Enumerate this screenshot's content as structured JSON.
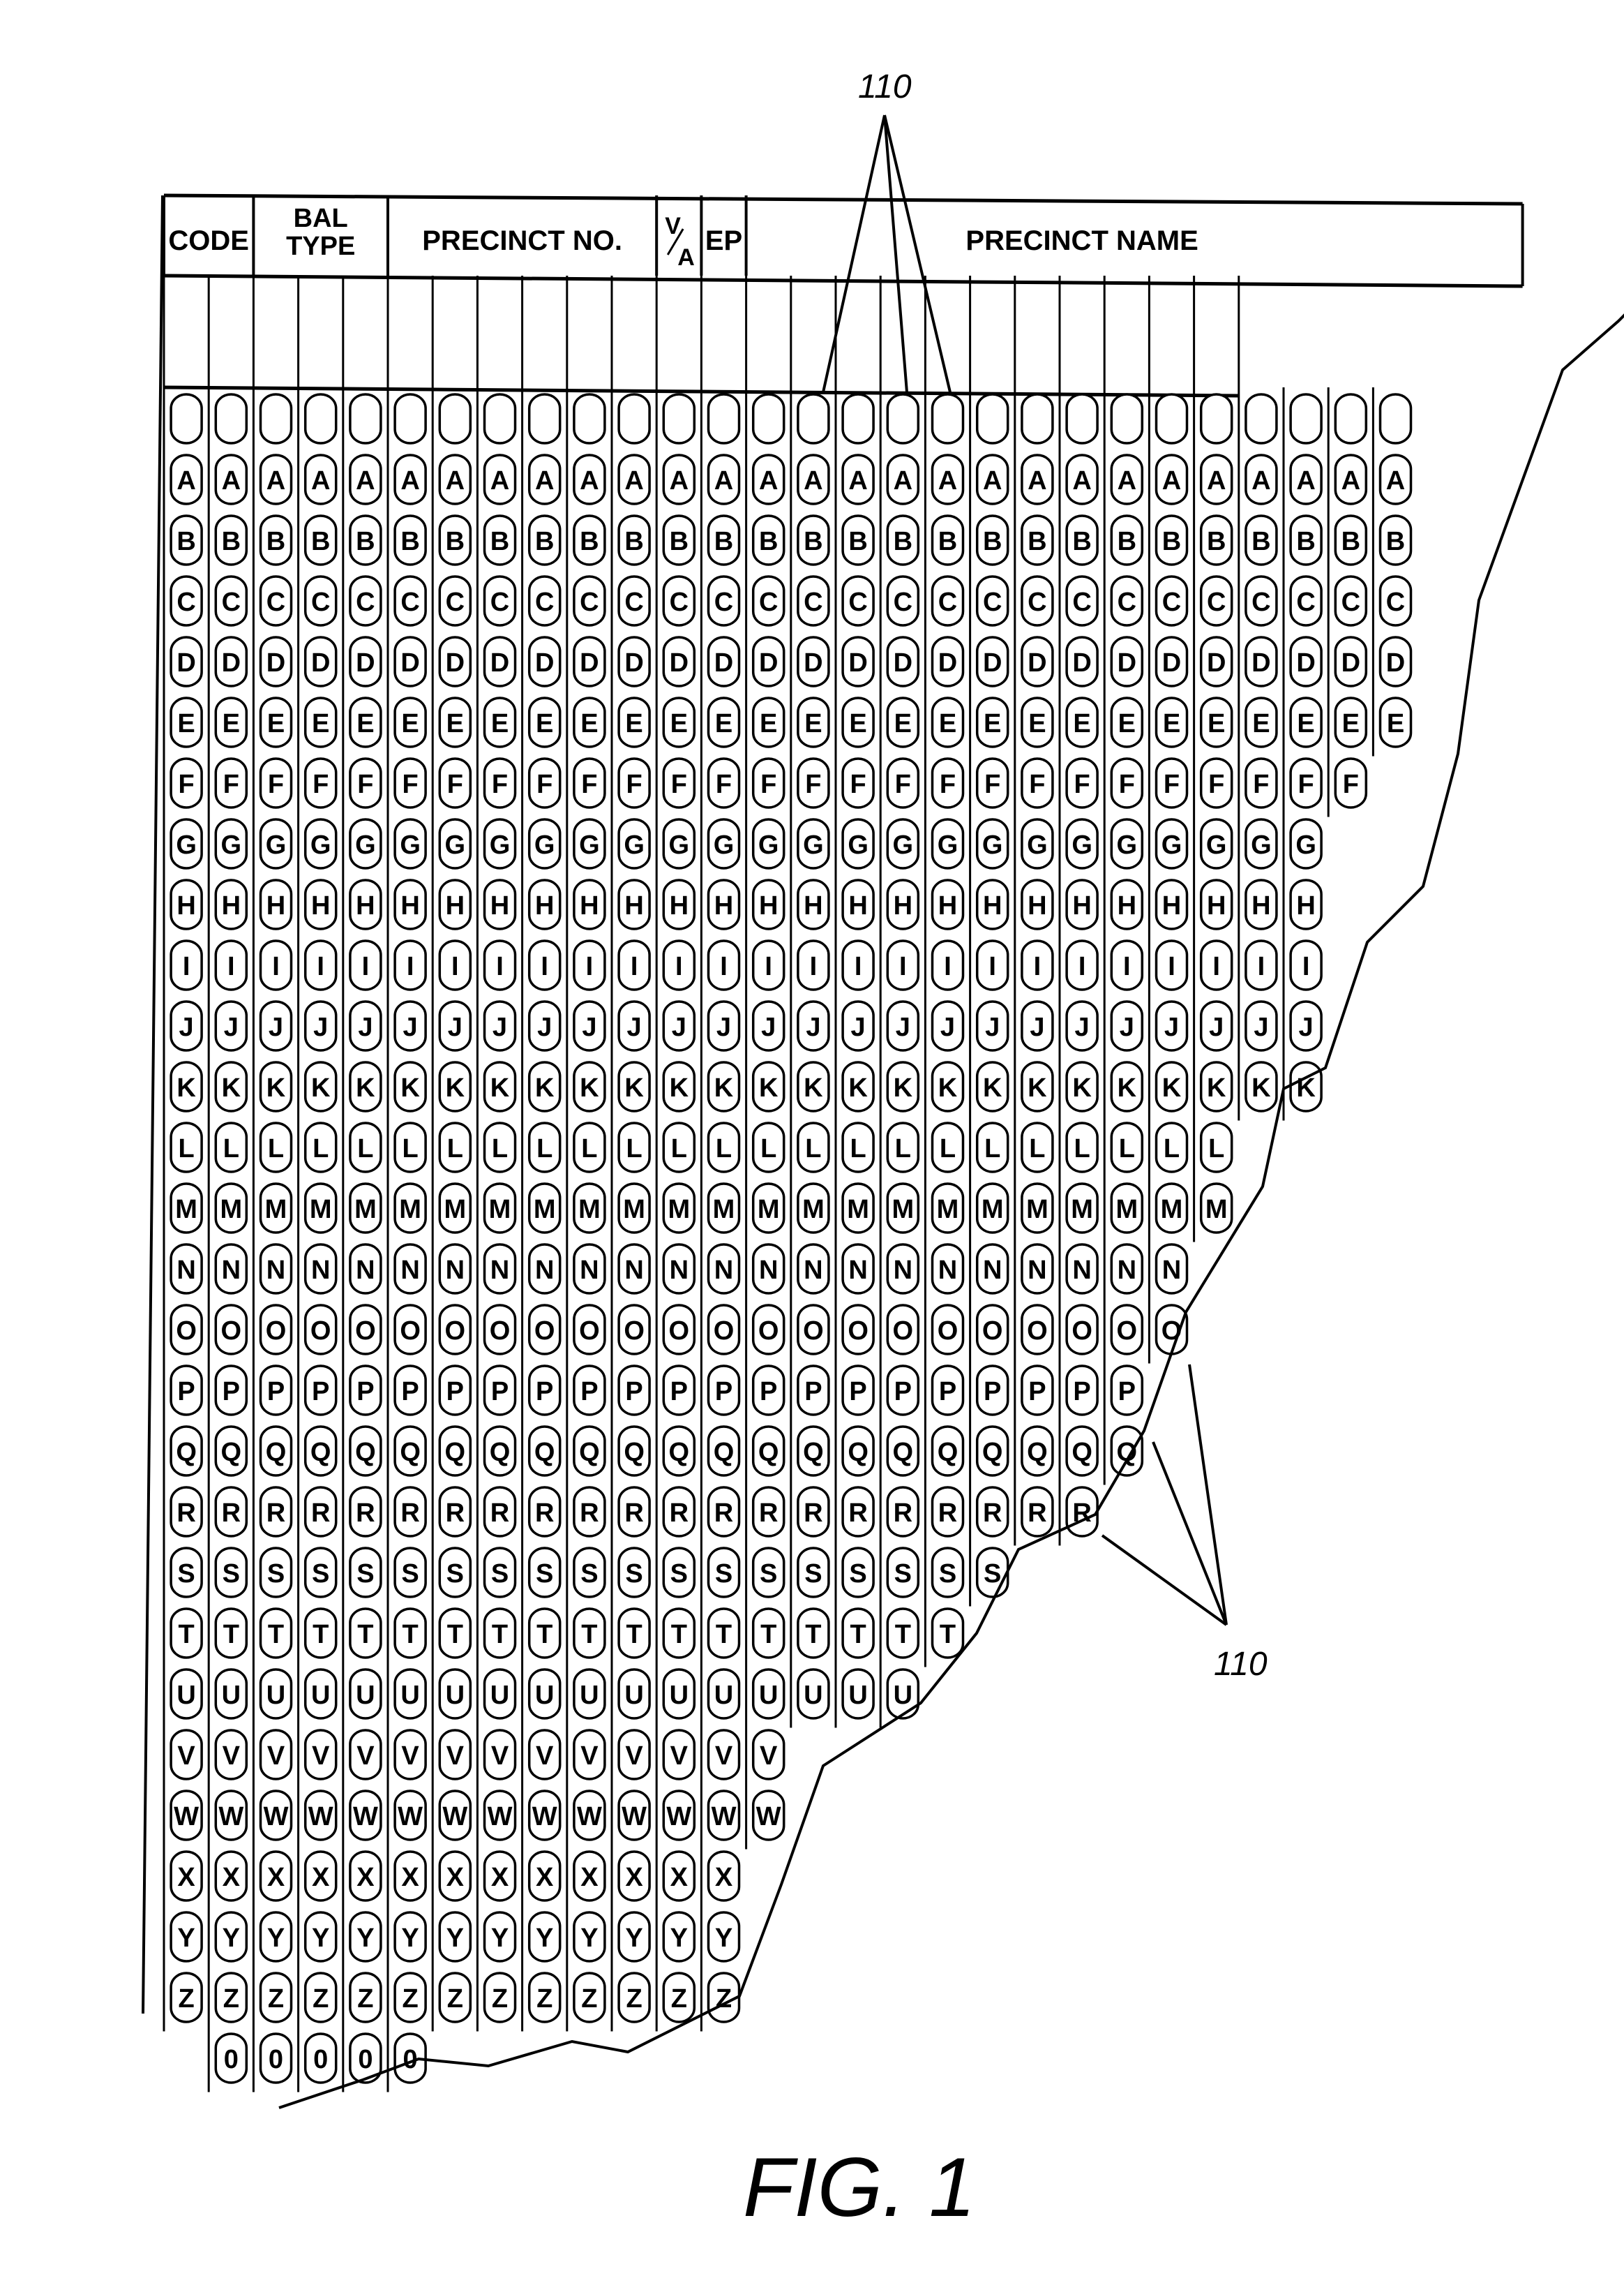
{
  "figure": {
    "caption": "FIG. 1",
    "reference_labels": [
      {
        "id": "top",
        "text": "110"
      },
      {
        "id": "bottom",
        "text": "110"
      }
    ]
  },
  "header": {
    "groups": [
      {
        "label": "CODE",
        "columns": 2
      },
      {
        "label_lines": [
          "BAL",
          "TYPE"
        ],
        "columns": 3
      },
      {
        "label": "PRECINCT NO.",
        "columns": 6
      },
      {
        "label_lines": [
          "V",
          "A"
        ],
        "stacked_fraction": true,
        "columns": 1
      },
      {
        "label": "EP",
        "columns": 1
      },
      {
        "label": "PRECINCT NAME",
        "columns": 15
      }
    ]
  },
  "grid": {
    "column_count": 28,
    "rows": [
      "",
      "A",
      "B",
      "C",
      "D",
      "E",
      "F",
      "G",
      "H",
      "I",
      "J",
      "K",
      "L",
      "M",
      "N",
      "O",
      "P",
      "Q",
      "R",
      "S",
      "T",
      "U",
      "V",
      "W",
      "X",
      "Y",
      "Z",
      "0"
    ],
    "last_visible_row_per_column": [
      "Z",
      "0",
      "0",
      "0",
      "0",
      "0",
      "Z",
      "Z",
      "Z",
      "Z",
      "Z",
      "Z",
      "Z",
      "W",
      "U",
      "U",
      "U",
      "T",
      "S",
      "R",
      "R",
      "Q",
      "O",
      "M",
      "K",
      "K",
      "F",
      "E"
    ]
  }
}
